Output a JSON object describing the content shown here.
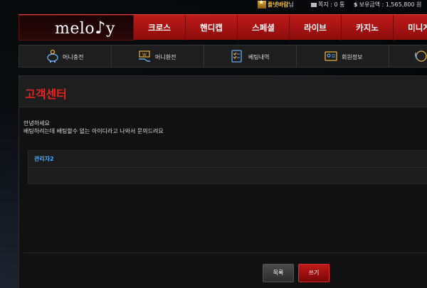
{
  "userbar": {
    "nickname": "플넷바람",
    "suffix": "님",
    "mail_label": "쪽지 : 0 통",
    "balance_label": "보유금액 : 1,565,800 원",
    "currency_symbol": "$"
  },
  "brand": {
    "logo_text": "melo",
    "logo_tail": "y",
    "logo_note": "♪"
  },
  "nav": {
    "items": [
      {
        "label": "크로스"
      },
      {
        "label": "핸디캡"
      },
      {
        "label": "스페셜"
      },
      {
        "label": "라이브"
      },
      {
        "label": "카지노"
      },
      {
        "label": "미니게"
      }
    ]
  },
  "quickmenu": {
    "items": [
      {
        "label": "머니충전",
        "icon": "piggy-bank-icon"
      },
      {
        "label": "머니환전",
        "icon": "money-exchange-icon"
      },
      {
        "label": "베팅내역",
        "icon": "checklist-icon"
      },
      {
        "label": "회원정보",
        "icon": "member-card-icon"
      },
      {
        "label": "",
        "icon": "support-24-icon"
      }
    ]
  },
  "panel": {
    "title": "고객센터",
    "message_greeting": "안녕하세요",
    "message_body": "배팅하려는데 배팅할수 없는 아이디라고 나와서 문의드려요",
    "reply_author": "관리자2"
  },
  "buttons": {
    "list": "목록",
    "write": "쓰기"
  },
  "colors": {
    "accent_red": "#e42323",
    "nav_red": "#b01414",
    "link_blue": "#4aa8ff",
    "gold": "#f0c040"
  }
}
